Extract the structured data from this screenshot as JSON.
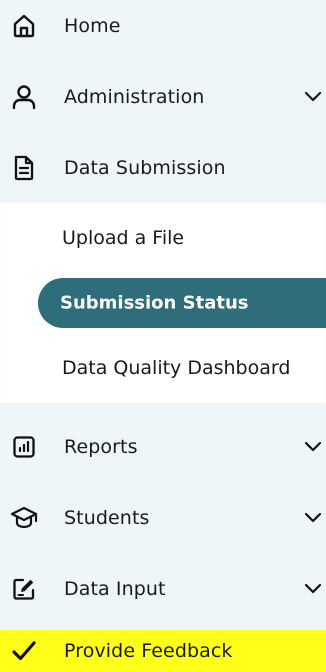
{
  "nav": {
    "home": {
      "label": "Home",
      "icon": "home-icon"
    },
    "administration": {
      "label": "Administration",
      "icon": "user-icon"
    },
    "data_submission": {
      "label": "Data Submission",
      "icon": "document-icon"
    },
    "submenu": [
      {
        "label": "Upload a File"
      },
      {
        "label": "Submission Status",
        "active": true
      },
      {
        "label": "Data Quality Dashboard"
      }
    ],
    "reports": {
      "label": "Reports",
      "icon": "bar-chart-icon"
    },
    "students": {
      "label": "Students",
      "icon": "graduation-cap-icon"
    },
    "data_input": {
      "label": "Data Input",
      "icon": "edit-icon"
    },
    "feedback": {
      "label": "Provide Feedback",
      "icon": "checkmark-icon"
    }
  },
  "colors": {
    "sidebar_bg": "#eef6f9",
    "active_bg": "#2f6d7a",
    "feedback_bg": "#ffff1a"
  }
}
